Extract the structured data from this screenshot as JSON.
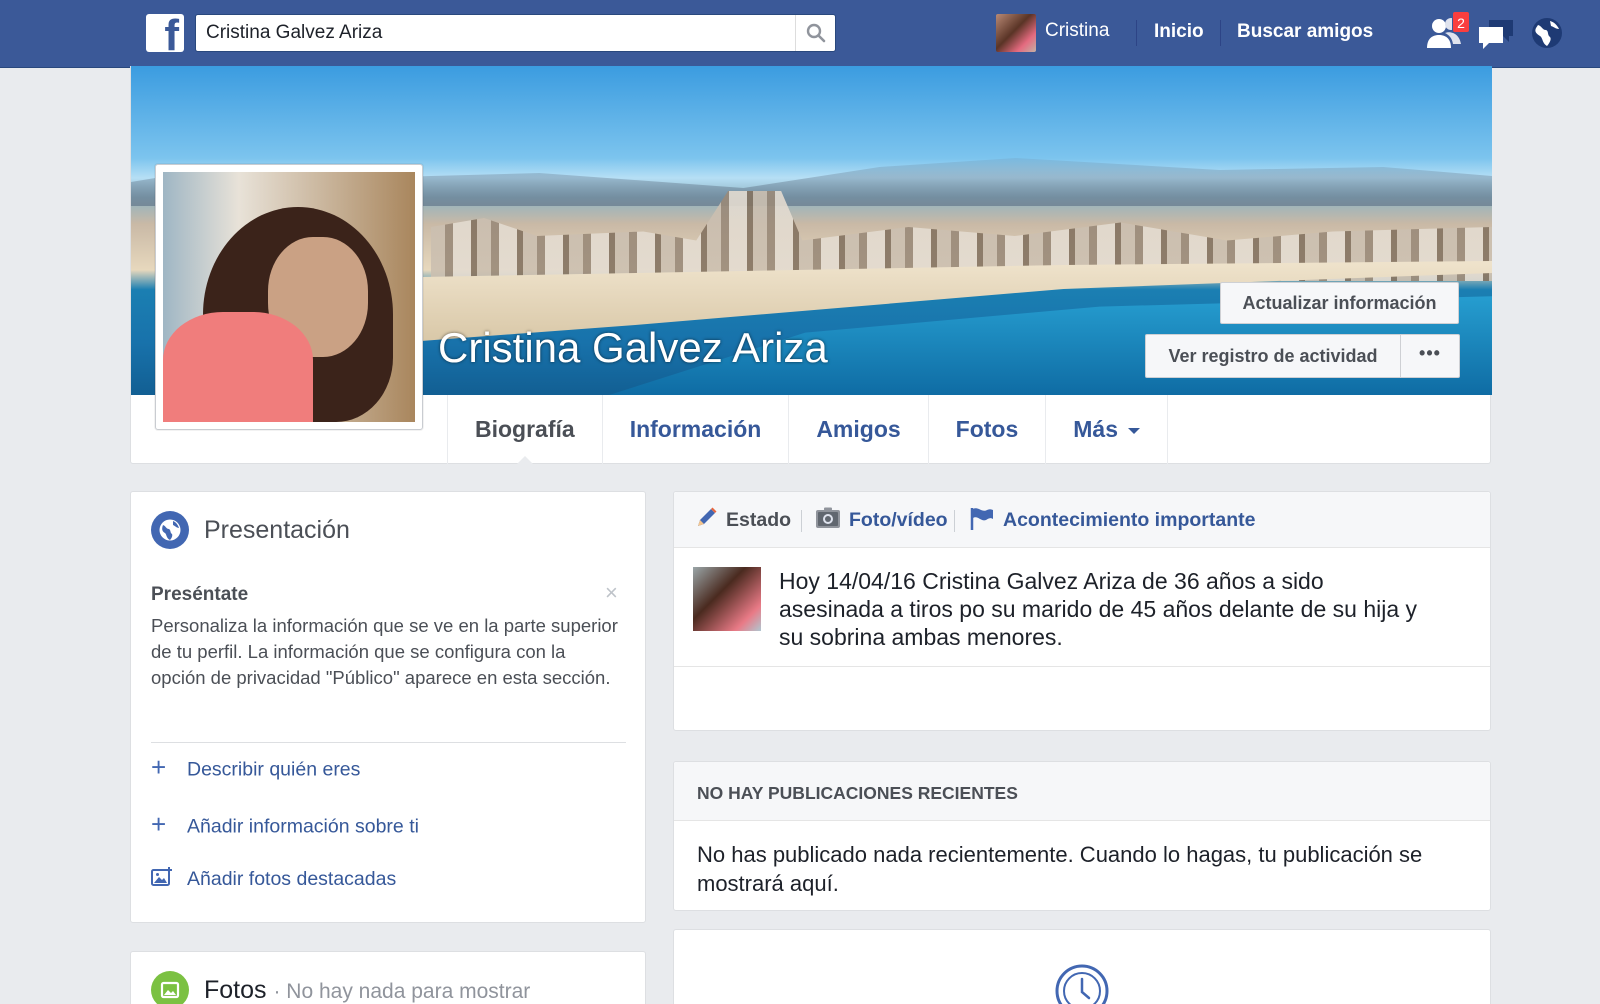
{
  "topbar": {
    "search_value": "Cristina Galvez Ariza",
    "user_name": "Cristina",
    "home_label": "Inicio",
    "find_friends_label": "Buscar amigos",
    "friend_requests_count": "2",
    "brand_color": "#3b5998"
  },
  "profile": {
    "name": "Cristina Galvez Ariza",
    "update_info_label": "Actualizar información",
    "activity_log_label": "Ver registro de actividad",
    "more_options_label": "•••",
    "tabs": [
      {
        "label": "Biografía"
      },
      {
        "label": "Información"
      },
      {
        "label": "Amigos"
      },
      {
        "label": "Fotos"
      },
      {
        "label": "Más"
      }
    ]
  },
  "intro": {
    "title": "Presentación",
    "subtitle": "Preséntate",
    "close_label": "×",
    "description": "Personaliza la información que se ve en la parte superior de tu perfil. La información que se configura con la opción de privacidad \"Público\" aparece en esta sección.",
    "actions": [
      {
        "label": "Describir quién eres",
        "icon": "plus-icon"
      },
      {
        "label": "Añadir información sobre ti",
        "icon": "plus-icon"
      },
      {
        "label": "Añadir fotos destacadas",
        "icon": "add-photo-icon"
      }
    ]
  },
  "photos_section": {
    "title": "Fotos",
    "empty_text": "· No hay nada para mostrar"
  },
  "composer": {
    "tabs": [
      {
        "label": "Estado",
        "icon": "pencil-icon"
      },
      {
        "label": "Foto/vídeo",
        "icon": "camera-icon"
      },
      {
        "label": "Acontecimiento importante",
        "icon": "flag-icon"
      }
    ],
    "post_text": "Hoy 14/04/16 Cristina Galvez Ariza de 36 años a sido asesinada a tiros po su marido de 45 años  delante de su hija y su sobrina ambas menores."
  },
  "recent_posts": {
    "title": "NO HAY PUBLICACIONES RECIENTES",
    "message": "No has publicado nada recientemente. Cuando lo hagas, tu publicación se mostrará aquí."
  }
}
